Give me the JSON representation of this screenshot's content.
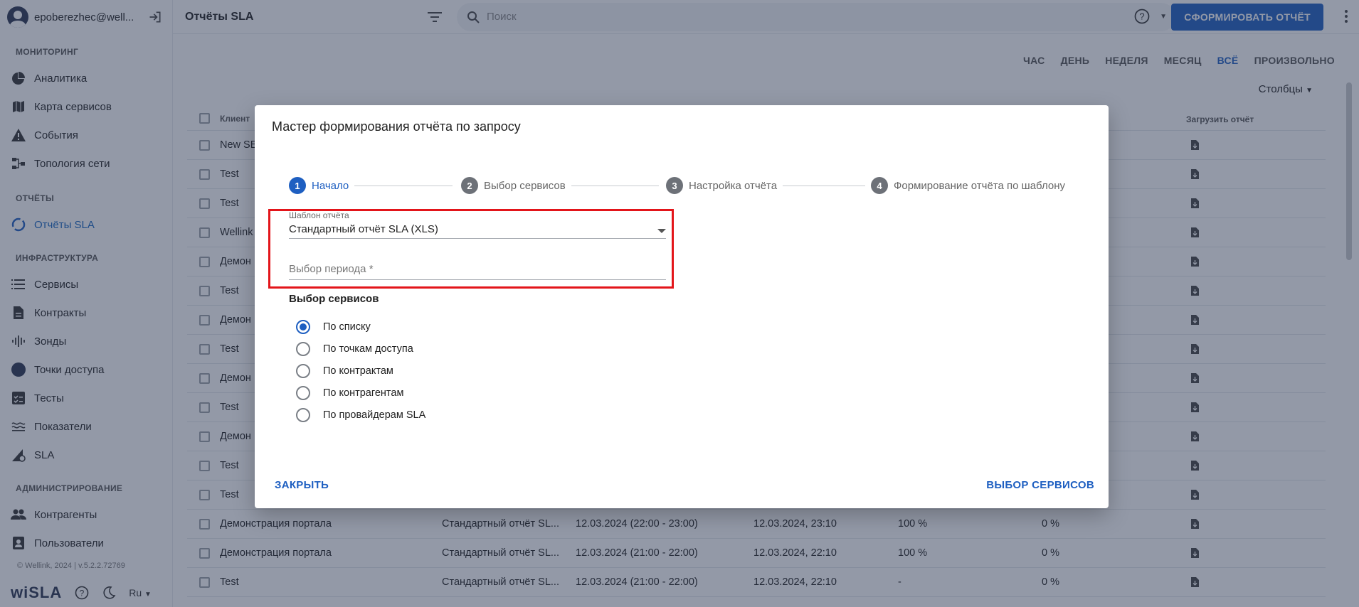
{
  "user": {
    "name": "epoberezhec@well..."
  },
  "sidebar": {
    "sections": [
      {
        "title": "МОНИТОРИНГ",
        "items": [
          {
            "label": "Аналитика",
            "icon": "pie-chart-icon"
          },
          {
            "label": "Карта сервисов",
            "icon": "map-icon"
          },
          {
            "label": "События",
            "icon": "warning-icon"
          },
          {
            "label": "Топология сети",
            "icon": "topology-icon"
          }
        ]
      },
      {
        "title": "ОТЧЁТЫ",
        "items": [
          {
            "label": "Отчёты SLA",
            "icon": "reports-icon",
            "active": true
          }
        ]
      },
      {
        "title": "ИНФРАСТРУКТУРА",
        "items": [
          {
            "label": "Сервисы",
            "icon": "list-icon"
          },
          {
            "label": "Контракты",
            "icon": "document-icon"
          },
          {
            "label": "Зонды",
            "icon": "probe-icon"
          },
          {
            "label": "Точки доступа",
            "icon": "circle-icon"
          },
          {
            "label": "Тесты",
            "icon": "checklist-icon"
          },
          {
            "label": "Показатели",
            "icon": "metrics-icon"
          },
          {
            "label": "SLA",
            "icon": "sla-icon"
          }
        ]
      },
      {
        "title": "АДМИНИСТРИРОВАНИЕ",
        "items": [
          {
            "label": "Контрагенты",
            "icon": "people-icon"
          },
          {
            "label": "Пользователи",
            "icon": "users-icon"
          }
        ]
      }
    ],
    "copyright": "© Wellink, 2024 | v.5.2.2.72769",
    "brand": "wiSLA",
    "language": "Ru"
  },
  "topbar": {
    "title": "Отчёты SLA",
    "search_placeholder": "Поиск",
    "primary_button": "СФОРМИРОВАТЬ ОТЧЁТ"
  },
  "periods": [
    "ЧАС",
    "ДЕНЬ",
    "НЕДЕЛЯ",
    "МЕСЯЦ",
    "ВСЁ",
    "ПРОИЗВОЛЬНО"
  ],
  "active_period": "ВСЁ",
  "columns_button": "Столбцы",
  "table": {
    "headers": {
      "client": "Клиент",
      "download": "Загрузить отчёт"
    },
    "rows": [
      {
        "client": "New SE",
        "template": "",
        "period": "",
        "created": "",
        "a": "",
        "b": ""
      },
      {
        "client": "Test",
        "template": "",
        "period": "",
        "created": "",
        "a": "",
        "b": ""
      },
      {
        "client": "Test",
        "template": "",
        "period": "",
        "created": "",
        "a": "",
        "b": ""
      },
      {
        "client": "Wellink",
        "template": "",
        "period": "",
        "created": "",
        "a": "",
        "b": ""
      },
      {
        "client": "Демон",
        "template": "",
        "period": "",
        "created": "",
        "a": "",
        "b": ""
      },
      {
        "client": "Test",
        "template": "",
        "period": "",
        "created": "",
        "a": "",
        "b": ""
      },
      {
        "client": "Демон",
        "template": "",
        "period": "",
        "created": "",
        "a": "",
        "b": ""
      },
      {
        "client": "Test",
        "template": "",
        "period": "",
        "created": "",
        "a": "",
        "b": ""
      },
      {
        "client": "Демон",
        "template": "",
        "period": "",
        "created": "",
        "a": "",
        "b": ""
      },
      {
        "client": "Test",
        "template": "",
        "period": "",
        "created": "",
        "a": "",
        "b": ""
      },
      {
        "client": "Демон",
        "template": "",
        "period": "",
        "created": "",
        "a": "",
        "b": ""
      },
      {
        "client": "Test",
        "template": "",
        "period": "",
        "created": "",
        "a": "",
        "b": ""
      },
      {
        "client": "Test",
        "template": "",
        "period": "",
        "created": "",
        "a": "",
        "b": ""
      },
      {
        "client": "Демонстрация портала",
        "template": "Стандартный отчёт SL...",
        "period": "12.03.2024 (22:00 - 23:00)",
        "created": "12.03.2024, 23:10",
        "a": "100 %",
        "b": "0 %"
      },
      {
        "client": "Демонстрация портала",
        "template": "Стандартный отчёт SL...",
        "period": "12.03.2024 (21:00 - 22:00)",
        "created": "12.03.2024, 22:10",
        "a": "100 %",
        "b": "0 %"
      },
      {
        "client": "Test",
        "template": "Стандартный отчёт SL...",
        "period": "12.03.2024 (21:00 - 22:00)",
        "created": "12.03.2024, 22:10",
        "a": "-",
        "b": "0 %"
      }
    ]
  },
  "dialog": {
    "title": "Мастер формирования отчёта по запросу",
    "steps": [
      {
        "num": "1",
        "label": "Начало",
        "active": true
      },
      {
        "num": "2",
        "label": "Выбор сервисов"
      },
      {
        "num": "3",
        "label": "Настройка отчёта"
      },
      {
        "num": "4",
        "label": "Формирование отчёта по шаблону"
      }
    ],
    "template_field": {
      "label": "Шаблон отчёта",
      "value": "Стандартный отчёт SLA (XLS)"
    },
    "period_field": {
      "placeholder": "Выбор периода *"
    },
    "services_heading": "Выбор сервисов",
    "options": [
      {
        "label": "По списку",
        "checked": true
      },
      {
        "label": "По точкам доступа"
      },
      {
        "label": "По контрактам"
      },
      {
        "label": "По контрагентам"
      },
      {
        "label": "По провайдерам SLA"
      }
    ],
    "close_button": "ЗАКРЫТЬ",
    "next_button": "ВЫБОР СЕРВИСОВ"
  },
  "colors": {
    "accent": "#1e5fc1",
    "highlight": "#e3151a"
  }
}
